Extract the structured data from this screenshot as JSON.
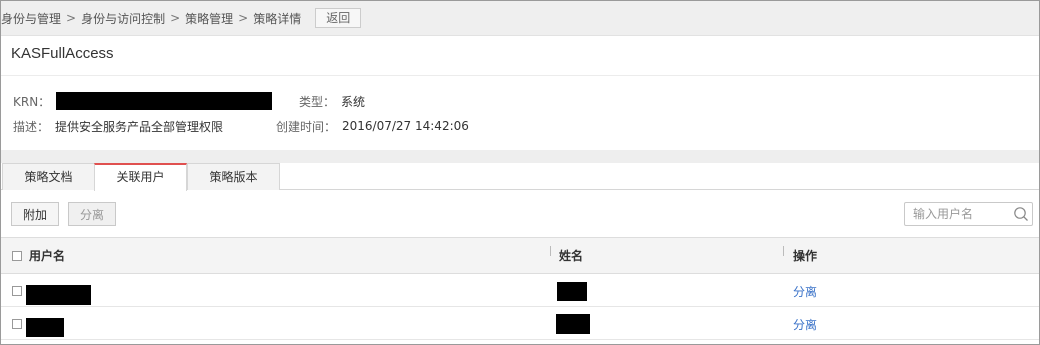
{
  "breadcrumb": {
    "items": [
      "身份与管理",
      "身份与访问控制",
      "策略管理"
    ],
    "separator": ">",
    "current": "策略详情",
    "back_label": "返回"
  },
  "policy": {
    "name": "KASFullAccess",
    "krn_label": "KRN：",
    "type_label": "类型：",
    "type_value": "系统",
    "desc_label": "描述：",
    "desc_value": "提供安全服务产品全部管理权限",
    "created_label": "创建时间：",
    "created_value": "2016/07/27 14:42:06"
  },
  "tabs": [
    {
      "label": "策略文档",
      "active": false
    },
    {
      "label": "关联用户",
      "active": true
    },
    {
      "label": "策略版本",
      "active": false
    }
  ],
  "toolbar": {
    "attach_label": "附加",
    "detach_label": "分离",
    "search_placeholder": "输入用户名"
  },
  "table": {
    "headers": [
      "用户名",
      "姓名",
      "操作"
    ],
    "rows": [
      {
        "action": "分离"
      },
      {
        "action": "分离"
      }
    ]
  },
  "colors": {
    "active_tab_accent": "#e0504f",
    "link": "#3a72c8",
    "redaction": "#000000"
  }
}
